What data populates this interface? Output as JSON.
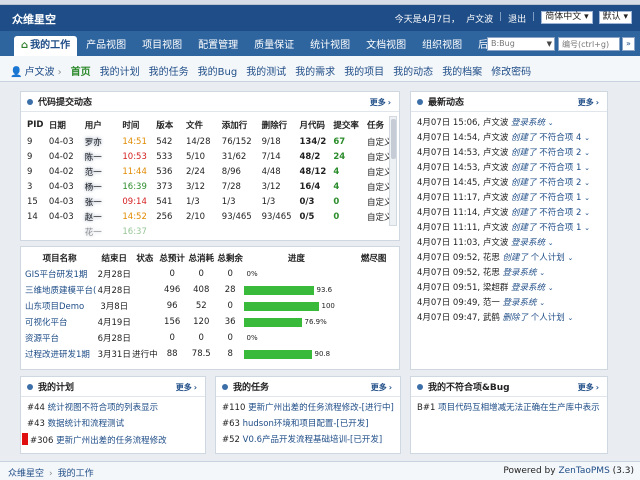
{
  "app": {
    "logo": "众维星空",
    "date_text": "今天是4月7日，",
    "user": "卢文波",
    "logout": "退出",
    "language": "简体中文",
    "theme": "默认"
  },
  "nav": {
    "tabs": [
      "我的工作",
      "产品视图",
      "项目视图",
      "配置管理",
      "质量保证",
      "统计视图",
      "文档视图",
      "组织视图",
      "后台管理"
    ],
    "bug_select": "B:Bug",
    "search_placeholder": "编号(ctrl+g)",
    "search_button": "»"
  },
  "subnav": {
    "user": "卢文波",
    "items": [
      "首页",
      "我的计划",
      "我的任务",
      "我的Bug",
      "我的测试",
      "我的需求",
      "我的项目",
      "我的动态",
      "我的档案",
      "修改密码"
    ]
  },
  "code_panel": {
    "title": "代码提交动态",
    "more": "更多",
    "headers": [
      "PID",
      "日期",
      "用户",
      "时间",
      "版本",
      "文件",
      "添加行",
      "删除行",
      "月代码",
      "提交率",
      "任务"
    ],
    "rows": [
      {
        "pid": "9",
        "date": "04-03",
        "user": "罗亦",
        "time": "14:51",
        "ver": "542",
        "files": "14/28",
        "add": "76/152",
        "del": "9/18",
        "month": "134/2",
        "rate": "67",
        "task": "自定义"
      },
      {
        "pid": "9",
        "date": "04-02",
        "user": "陈一",
        "time": "10:53",
        "ver": "533",
        "files": "5/10",
        "add": "31/62",
        "del": "7/14",
        "month": "48/2",
        "rate": "24",
        "task": "自定义"
      },
      {
        "pid": "9",
        "date": "04-02",
        "user": "范一",
        "time": "11:44",
        "ver": "536",
        "files": "2/24",
        "add": "8/96",
        "del": "4/48",
        "month": "48/12",
        "rate": "4",
        "task": "自定义"
      },
      {
        "pid": "3",
        "date": "04-03",
        "user": "杨一",
        "time": "16:39",
        "ver": "373",
        "files": "3/12",
        "add": "7/28",
        "del": "3/12",
        "month": "16/4",
        "rate": "4",
        "task": "自定义"
      },
      {
        "pid": "15",
        "date": "04-03",
        "user": "张一",
        "time": "09:14",
        "ver": "541",
        "files": "1/3",
        "add": "1/3",
        "del": "1/3",
        "month": "0/3",
        "rate": "0",
        "task": "自定义"
      },
      {
        "pid": "14",
        "date": "04-03",
        "user": "赵一",
        "time": "14:52",
        "ver": "256",
        "files": "2/10",
        "add": "93/465",
        "del": "93/465",
        "month": "0/5",
        "rate": "0",
        "task": "自定义"
      },
      {
        "pid": "",
        "date": "",
        "user": "花一",
        "time": "16:37",
        "ver": "",
        "files": "",
        "add": "",
        "del": "",
        "month": "",
        "rate": "",
        "task": ""
      }
    ]
  },
  "project_panel": {
    "headers": [
      "项目名称",
      "结束日",
      "状态",
      "总预计",
      "总消耗",
      "总剩余",
      "进度",
      "燃尽图"
    ],
    "rows": [
      {
        "name": "GIS平台研发1期",
        "end": "2月28日",
        "status": "",
        "est": "0",
        "cons": "0",
        "left": "0",
        "progress": 0,
        "label": "0%"
      },
      {
        "name": "三维地质建模平台(",
        "end": "4月28日",
        "status": "",
        "est": "496",
        "cons": "408",
        "left": "28",
        "progress": 93.6,
        "label": "93.6"
      },
      {
        "name": "山东项目Demo",
        "end": "3月8日",
        "status": "",
        "est": "96",
        "cons": "52",
        "left": "0",
        "progress": 100,
        "label": "100"
      },
      {
        "name": "可视化平台",
        "end": "4月19日",
        "status": "",
        "est": "156",
        "cons": "120",
        "left": "36",
        "progress": 76.9,
        "label": "76.9%"
      },
      {
        "name": "资源平台",
        "end": "6月28日",
        "status": "",
        "est": "0",
        "cons": "0",
        "left": "0",
        "progress": 0,
        "label": "0%"
      },
      {
        "name": "过程改进研发1期",
        "end": "3月31日",
        "status": "进行中",
        "est": "88",
        "cons": "78.5",
        "left": "8",
        "progress": 90.8,
        "label": "90.8"
      }
    ]
  },
  "dynamics_panel": {
    "title": "最新动态",
    "more": "更多",
    "items": [
      {
        "time": "4月07日 15:06,",
        "user": "卢文波",
        "action": "登录系统",
        "obj": "",
        "num": ""
      },
      {
        "time": "4月07日 14:54,",
        "user": "卢文波",
        "action": "创建了",
        "obj": "不符合项",
        "num": "4"
      },
      {
        "time": "4月07日 14:53,",
        "user": "卢文波",
        "action": "创建了",
        "obj": "不符合项",
        "num": "2"
      },
      {
        "time": "4月07日 14:53,",
        "user": "卢文波",
        "action": "创建了",
        "obj": "不符合项",
        "num": "1"
      },
      {
        "time": "4月07日 14:45,",
        "user": "卢文波",
        "action": "创建了",
        "obj": "不符合项",
        "num": "2"
      },
      {
        "time": "4月07日 11:17,",
        "user": "卢文波",
        "action": "创建了",
        "obj": "不符合项",
        "num": "1"
      },
      {
        "time": "4月07日 11:14,",
        "user": "卢文波",
        "action": "创建了",
        "obj": "不符合项",
        "num": "2"
      },
      {
        "time": "4月07日 11:11,",
        "user": "卢文波",
        "action": "创建了",
        "obj": "不符合项",
        "num": "1"
      },
      {
        "time": "4月07日 11:03,",
        "user": "卢文波",
        "action": "登录系统",
        "obj": "",
        "num": ""
      },
      {
        "time": "4月07日 09:52,",
        "user": "花思",
        "action": "创建了",
        "obj": "个人计划",
        "num": ""
      },
      {
        "time": "4月07日 09:52,",
        "user": "花思",
        "action": "登录系统",
        "obj": "",
        "num": ""
      },
      {
        "time": "4月07日 09:51,",
        "user": "梁超群",
        "action": "登录系统",
        "obj": "",
        "num": ""
      },
      {
        "time": "4月07日 09:49,",
        "user": "范一",
        "action": "登录系统",
        "obj": "",
        "num": ""
      },
      {
        "time": "4月07日 09:47,",
        "user": "武鹤",
        "action": "删除了",
        "obj": "个人计划",
        "num": ""
      }
    ]
  },
  "plan_panel": {
    "title": "我的计划",
    "more": "更多",
    "items": [
      {
        "num": "#44",
        "text": "统计视图不符合项的列表显示"
      },
      {
        "num": "#43",
        "text": "数据统计和流程测试"
      },
      {
        "num": "#306",
        "text": "更新广州出差的任务流程修改"
      }
    ]
  },
  "task_panel": {
    "title": "我的任务",
    "more": "更多",
    "items": [
      {
        "num": "#110",
        "text": "更新广州出差的任务流程修改-[进行中]"
      },
      {
        "num": "#63",
        "text": "hudson环境和项目配置-[已开发]"
      },
      {
        "num": "#52",
        "text": "V0.6产品开发流程基础培训-[已开发]"
      }
    ]
  },
  "bug_panel": {
    "title": "我的不符合项&Bug",
    "more": "更多",
    "items": [
      {
        "num": "B#1",
        "text": "项目代码互相增减无法正确在生产库中表示"
      }
    ]
  },
  "footer": {
    "crumb1": "众维星空",
    "crumb2": "我的工作",
    "powered": "Powered by",
    "brand": "ZenTaoPMS",
    "version": "(3.3)"
  },
  "colors": {
    "header": "#1f4d87",
    "nav": "#2f659f",
    "progress": "#3aba3a",
    "accent_green": "#2c8a2c"
  }
}
